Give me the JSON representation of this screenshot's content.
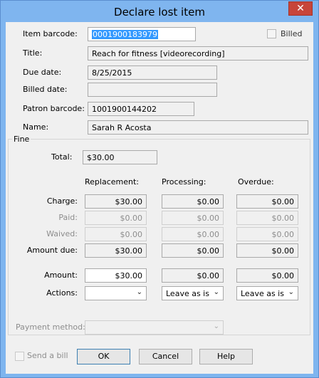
{
  "window": {
    "title": "Declare lost item",
    "close_glyph": "✕"
  },
  "item": {
    "barcode_label": "Item barcode:",
    "barcode_value": "0001900183979",
    "billed_label": "Billed",
    "title_label": "Title:",
    "title_value": "Reach for fitness [videorecording]",
    "due_label": "Due date:",
    "due_value": "8/25/2015",
    "billed_date_label": "Billed date:",
    "billed_date_value": "",
    "patron_barcode_label": "Patron barcode:",
    "patron_barcode_value": "1001900144202",
    "name_label": "Name:",
    "name_value": "Sarah R Acosta"
  },
  "fine": {
    "group_label": "Fine",
    "total_label": "Total:",
    "total_value": "$30.00",
    "columns": [
      "Replacement:",
      "Processing:",
      "Overdue:"
    ],
    "rows": [
      {
        "label": "Charge:",
        "values": [
          "$30.00",
          "$0.00",
          "$0.00"
        ],
        "disabled": false
      },
      {
        "label": "Paid:",
        "values": [
          "$0.00",
          "$0.00",
          "$0.00"
        ],
        "disabled": true
      },
      {
        "label": "Waived:",
        "values": [
          "$0.00",
          "$0.00",
          "$0.00"
        ],
        "disabled": true
      },
      {
        "label": "Amount due:",
        "values": [
          "$30.00",
          "$0.00",
          "$0.00"
        ],
        "disabled": false
      }
    ],
    "amount_label": "Amount:",
    "amount_values": [
      "$30.00",
      "$0.00",
      "$0.00"
    ],
    "actions_label": "Actions:",
    "actions_values": [
      "",
      "Leave as is",
      "Leave as is"
    ],
    "payment_method_label": "Payment method:",
    "payment_method_value": ""
  },
  "footer": {
    "send_bill_label": "Send a bill",
    "ok_label": "OK",
    "cancel_label": "Cancel",
    "help_label": "Help"
  },
  "colors": {
    "titlebar": "#7fb5ef",
    "client": "#f0f0f0",
    "close": "#c7453a",
    "selection": "#3399ff"
  },
  "icons": {
    "close": "close-icon",
    "dropdown": "chevron-down-icon"
  }
}
